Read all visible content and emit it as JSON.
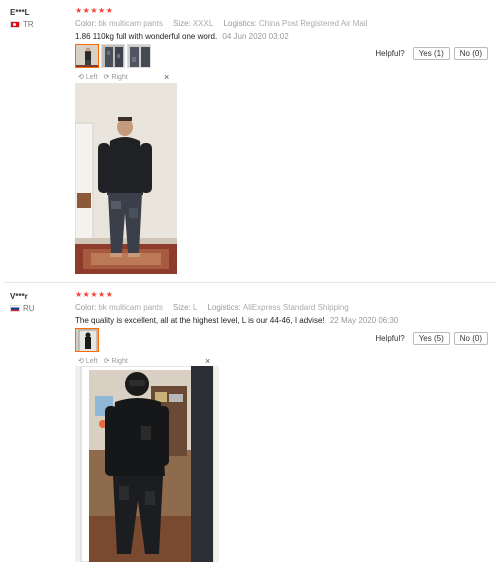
{
  "reviews": [
    {
      "user": "E***L",
      "country": "TR",
      "stars": "★★★★★",
      "color_label": "Color:",
      "color_value": "bk multicam pants",
      "size_label": "Size:",
      "size_value": "XXXL",
      "logistics_label": "Logistics:",
      "logistics_value": "China Post Registered Air Mail",
      "text": "1.86 110kg full with wonderful one word.",
      "date": "04 Jun 2020 03:02",
      "helpful_label": "Helpful?",
      "yes_label": "Yes (1)",
      "no_label": "No (0)",
      "viewer_left": "Left",
      "viewer_right": "Right",
      "viewer_close": "×",
      "thumbnail_count": 3
    },
    {
      "user": "V***r",
      "country": "RU",
      "stars": "★★★★★",
      "color_label": "Color:",
      "color_value": "bk multicam pants",
      "size_label": "Size:",
      "size_value": "L",
      "logistics_label": "Logistics:",
      "logistics_value": "AliExpress Standard Shipping",
      "text": "The quality is excellent, all at the highest level, L is our 44-46, I advise!",
      "date": "22 May 2020 06:30",
      "helpful_label": "Helpful?",
      "yes_label": "Yes (5)",
      "no_label": "No (0)",
      "viewer_left": "Left",
      "viewer_right": "Right",
      "viewer_close": "×",
      "thumbnail_count": 1
    }
  ],
  "colors": {
    "stars": "#f44336",
    "thumb_active_border": "#ff6a00",
    "meta_text": "#999999"
  },
  "icons": {
    "rotate_left": "rotate-left-icon",
    "rotate_right": "rotate-right-icon",
    "close": "close-icon",
    "flag_tr": "turkey-flag-icon",
    "flag_ru": "russia-flag-icon"
  }
}
